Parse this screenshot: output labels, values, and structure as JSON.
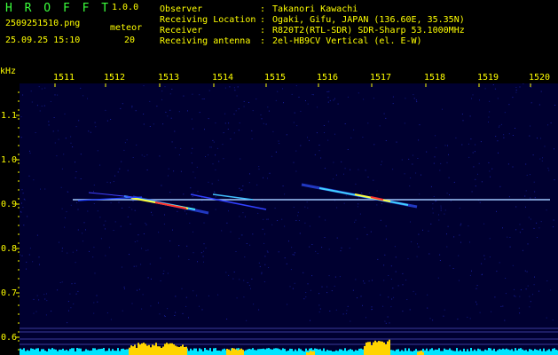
{
  "header": {
    "app_name": "H R O F F T",
    "version": "1.0.0",
    "filename": "2509251510.png",
    "meteor_label": "meteor",
    "timestamp": "25.09.25 15:10",
    "meteor_count": "20"
  },
  "info": [
    {
      "key": "Observer",
      "sep": ":",
      "value": "Takanori Kawachi"
    },
    {
      "key": "Receiving Location",
      "sep": ":",
      "value": "Ogaki, Gifu, JAPAN (136.60E, 35.35N)"
    },
    {
      "key": "Receiver",
      "sep": ":",
      "value": "R820T2(RTL-SDR) SDR-Sharp 53.1000MHz"
    },
    {
      "key": "Receiving antenna",
      "sep": ":",
      "value": "2el-HB9CV Vertical (el. E-W)"
    }
  ],
  "spectrogram": {
    "freq_unit": "kHz",
    "freq_axis_ticks": [
      "1.1",
      "1.0",
      "0.9",
      "0.8",
      "0.7",
      "0.6"
    ],
    "time_axis_ticks": [
      "1511",
      "1512",
      "1513",
      "1514",
      "1515",
      "1516",
      "1517",
      "1518",
      "1519",
      "1520"
    ],
    "colors": {
      "background": "#000030",
      "grid": "#3a3a9a",
      "text": "#ffff00",
      "carrier": "#a0c8ff",
      "hot": "#ff3030",
      "warm": "#ffff40",
      "level_bars": "#00e5ff",
      "level_peaks": "#ffd400"
    }
  }
}
